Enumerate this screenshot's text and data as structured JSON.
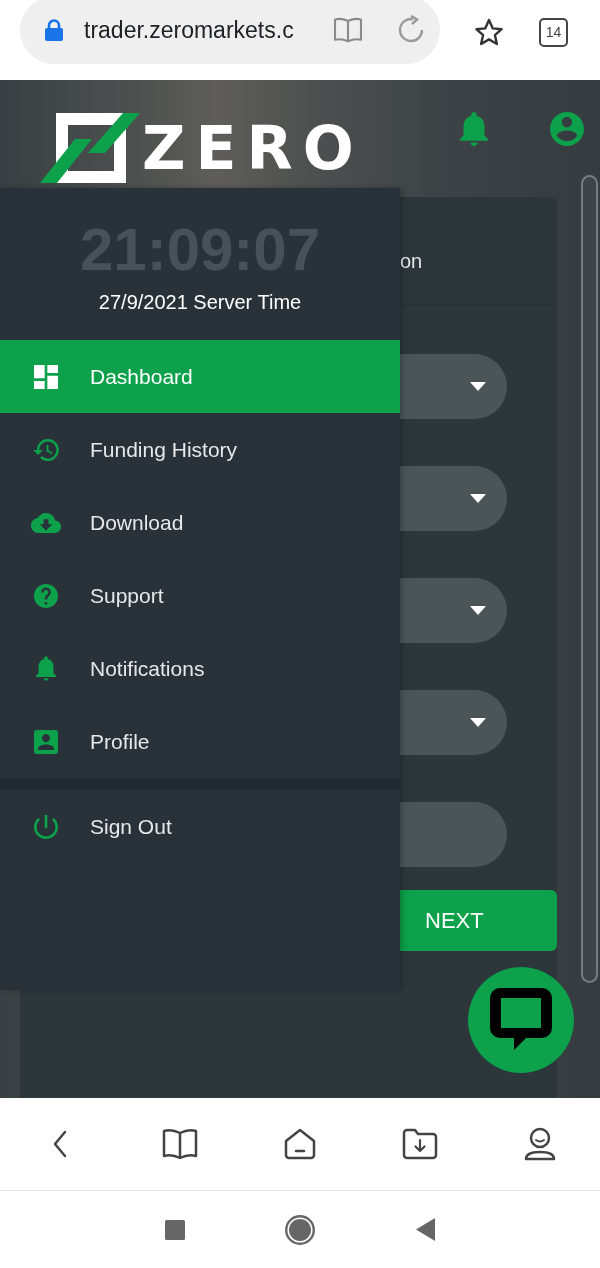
{
  "browser": {
    "url": "trader.zeromarkets.c",
    "tab_count": "14"
  },
  "header": {
    "logo_text": "ZERO"
  },
  "card": {
    "title": "on",
    "fields": [
      {
        "kind": "select"
      },
      {
        "kind": "select"
      },
      {
        "kind": "select"
      },
      {
        "kind": "select"
      },
      {
        "kind": "text"
      }
    ],
    "next_button": "NEXT"
  },
  "drawer": {
    "clock": "21:09:07",
    "server_date": "27/9/2021 Server Time",
    "items": [
      {
        "label": "Dashboard",
        "selected": true
      },
      {
        "label": "Funding History",
        "selected": false
      },
      {
        "label": "Download",
        "selected": false
      },
      {
        "label": "Support",
        "selected": false
      },
      {
        "label": "Notifications",
        "selected": false
      },
      {
        "label": "Profile",
        "selected": false
      }
    ],
    "footer_items": [
      {
        "label": "Sign Out",
        "selected": false
      }
    ]
  }
}
